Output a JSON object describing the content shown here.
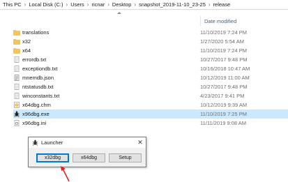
{
  "breadcrumb": {
    "items": [
      "This PC",
      "Local Disk (C:)",
      "Users",
      "ricnar",
      "Desktop",
      "snapshot_2019-11-10_23-25",
      "release"
    ],
    "separator": "›"
  },
  "columns": {
    "date_modified": "Date modified"
  },
  "files": [
    {
      "name": "translations",
      "date": "11/10/2019 7:24 PM",
      "icon": "folder-icon"
    },
    {
      "name": "x32",
      "date": "1/27/2020 5:54 AM",
      "icon": "folder-icon"
    },
    {
      "name": "x64",
      "date": "11/10/2019 7:24 PM",
      "icon": "folder-icon"
    },
    {
      "name": "errordb.txt",
      "date": "10/27/2017 9:48 PM",
      "icon": "text-file-icon"
    },
    {
      "name": "exceptiondb.txt",
      "date": "10/16/2018 10:47 AM",
      "icon": "text-file-icon"
    },
    {
      "name": "mnemdb.json",
      "date": "10/12/2019 11:00 AM",
      "icon": "json-file-icon"
    },
    {
      "name": "ntstatusdb.txt",
      "date": "10/27/2017 9:48 PM",
      "icon": "text-file-icon"
    },
    {
      "name": "winconstants.txt",
      "date": "4/23/2017 9:41 PM",
      "icon": "text-file-icon"
    },
    {
      "name": "x64dbg.chm",
      "date": "10/12/2019 9:39 AM",
      "icon": "help-file-icon"
    },
    {
      "name": "x96dbg.exe",
      "date": "11/10/2019 7:25 PM",
      "icon": "bug-exe-icon"
    },
    {
      "name": "x96dbg.ini",
      "date": "11/11/2019 9:08 AM",
      "icon": "ini-file-icon"
    }
  ],
  "selected_index": 9,
  "launcher": {
    "title": "Launcher",
    "close_glyph": "✕",
    "buttons": [
      "x32dbg",
      "x64dbg",
      "Setup"
    ],
    "default_button": "x32dbg"
  },
  "colors": {
    "selection": "#cce8ff",
    "folder": "#f4c55c",
    "accent": "#0078d7",
    "arrow": "#e02020"
  }
}
